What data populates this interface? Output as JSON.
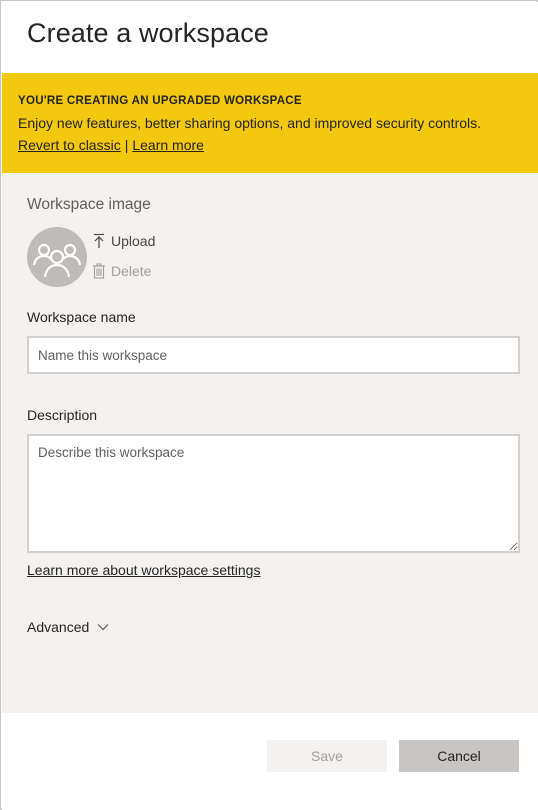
{
  "dialog": {
    "title": "Create a workspace"
  },
  "banner": {
    "heading": "YOU'RE CREATING AN UPGRADED WORKSPACE",
    "text": "Enjoy new features, better sharing options, and improved security controls.",
    "revert_link": "Revert to classic",
    "separator": "|",
    "learn_more_link": "Learn more",
    "background_color": "#f2c811"
  },
  "workspace_image": {
    "label": "Workspace image",
    "avatar_icon": "people-group-icon",
    "upload_label": "Upload",
    "upload_icon": "upload-arrow-icon",
    "delete_label": "Delete",
    "delete_icon": "trash-icon"
  },
  "workspace_name": {
    "label": "Workspace name",
    "placeholder": "Name this workspace",
    "value": ""
  },
  "description": {
    "label": "Description",
    "placeholder": "Describe this workspace",
    "value": ""
  },
  "settings_link": "Learn more about workspace settings",
  "advanced": {
    "label": "Advanced",
    "icon": "chevron-down-icon"
  },
  "footer": {
    "save_label": "Save",
    "cancel_label": "Cancel"
  }
}
